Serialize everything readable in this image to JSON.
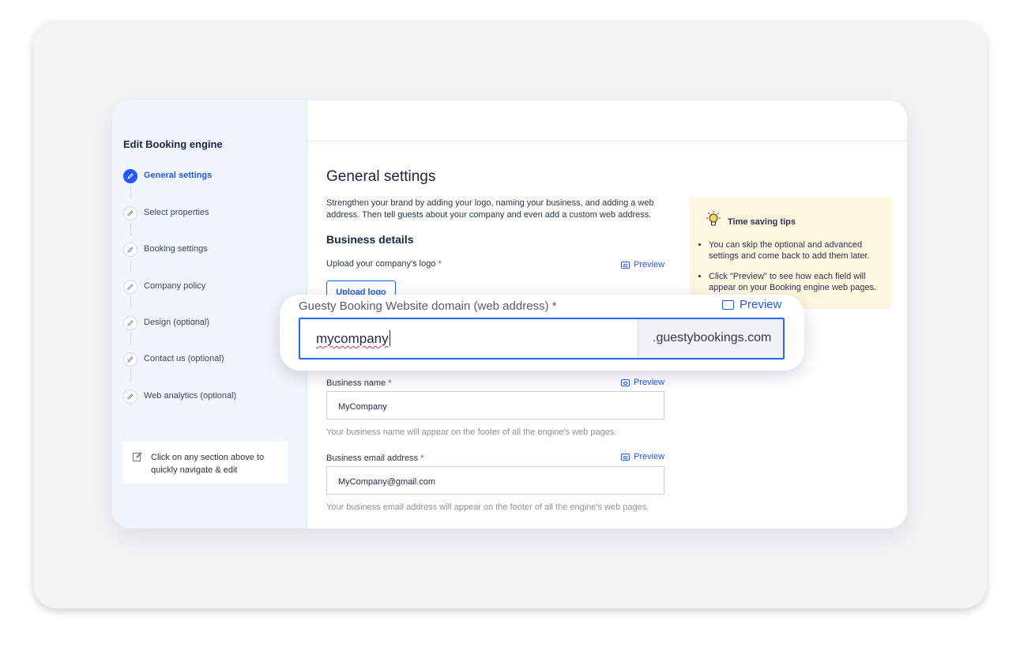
{
  "sidebar": {
    "title": "Edit Booking engine",
    "steps": [
      {
        "label": "General settings",
        "icon": "pencil-icon",
        "active": true
      },
      {
        "label": "Select properties",
        "icon": "pencil-icon",
        "active": false
      },
      {
        "label": "Booking settings",
        "icon": "pencil-icon",
        "active": false
      },
      {
        "label": "Company policy",
        "icon": "pencil-icon",
        "active": false
      },
      {
        "label": "Design (optional)",
        "icon": "pencil-icon",
        "active": false
      },
      {
        "label": "Contact us (optional)",
        "icon": "pencil-icon",
        "active": false
      },
      {
        "label": "Web analytics (optional)",
        "icon": "pencil-icon",
        "active": false
      }
    ],
    "hint": {
      "icon": "edit-note-icon",
      "text": "Click on any section above to quickly navigate & edit"
    }
  },
  "main": {
    "title": "General settings",
    "description": "Strengthen your brand by adding your logo, naming your business, and adding a web address. Then tell guests about your company and even add a custom web address.",
    "section_title": "Business details",
    "logo": {
      "label": "Upload your company's logo",
      "required_mark": "*",
      "button_label": "Upload logo",
      "preview_label": "Preview"
    },
    "business_name": {
      "label": "Business name",
      "required_mark": "*",
      "value": "MyCompany",
      "help": "Your business name will appear on the footer of all the engine's web pages.",
      "preview_label": "Preview"
    },
    "business_email": {
      "label": "Business email address",
      "required_mark": "*",
      "value": "MyCompany@gmail.com",
      "help": "Your business email address will appear on the footer of all the engine's web pages.",
      "preview_label": "Preview"
    }
  },
  "tips": {
    "icon": "lightbulb-icon",
    "title": "Time saving tips",
    "items": [
      "You can skip the optional and advanced settings and come back to add them later.",
      "Click \"Preview\" to see how each field will appear on your Booking engine web pages."
    ]
  },
  "domain_popout": {
    "label": "Guesty Booking Website domain (web address)",
    "required_mark": "*",
    "preview_label": "Preview",
    "value": "mycompany",
    "suffix": ".guestybookings.com"
  },
  "colors": {
    "accent": "#2457f5",
    "required": "#e0323c",
    "sidebar_bg": "#f1f5fd",
    "tips_bg": "#fef7e1"
  }
}
